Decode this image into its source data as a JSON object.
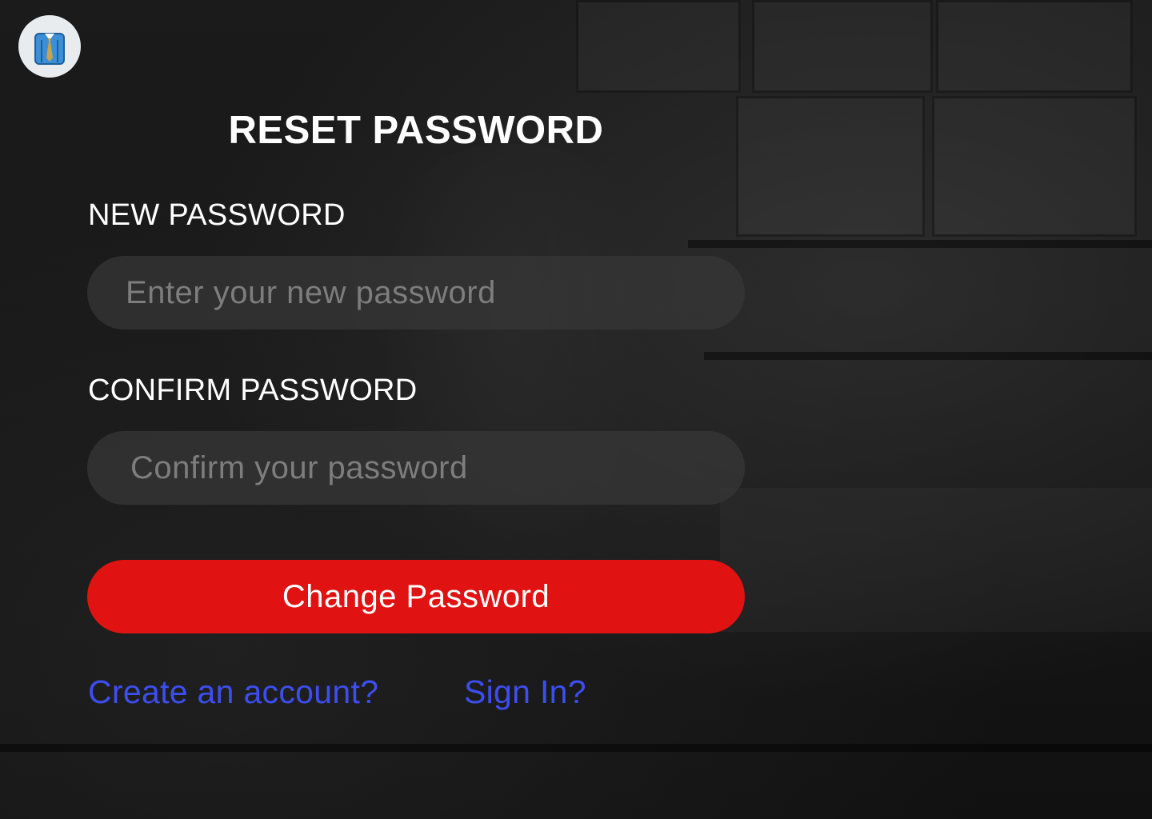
{
  "app": {
    "logo_icon": "shirt-and-tie-icon"
  },
  "form": {
    "title": "RESET PASSWORD",
    "new_password": {
      "label": "NEW PASSWORD",
      "placeholder": "Enter your new password",
      "value": ""
    },
    "confirm_password": {
      "label": "CONFIRM PASSWORD",
      "placeholder": "Confirm your password",
      "value": ""
    },
    "submit_label": "Change Password"
  },
  "links": {
    "create_account": "Create an account?",
    "sign_in": "Sign In?"
  },
  "colors": {
    "primary_button": "#e11212",
    "link": "#3d4ef0",
    "text": "#ffffff",
    "input_bg": "#383838"
  }
}
